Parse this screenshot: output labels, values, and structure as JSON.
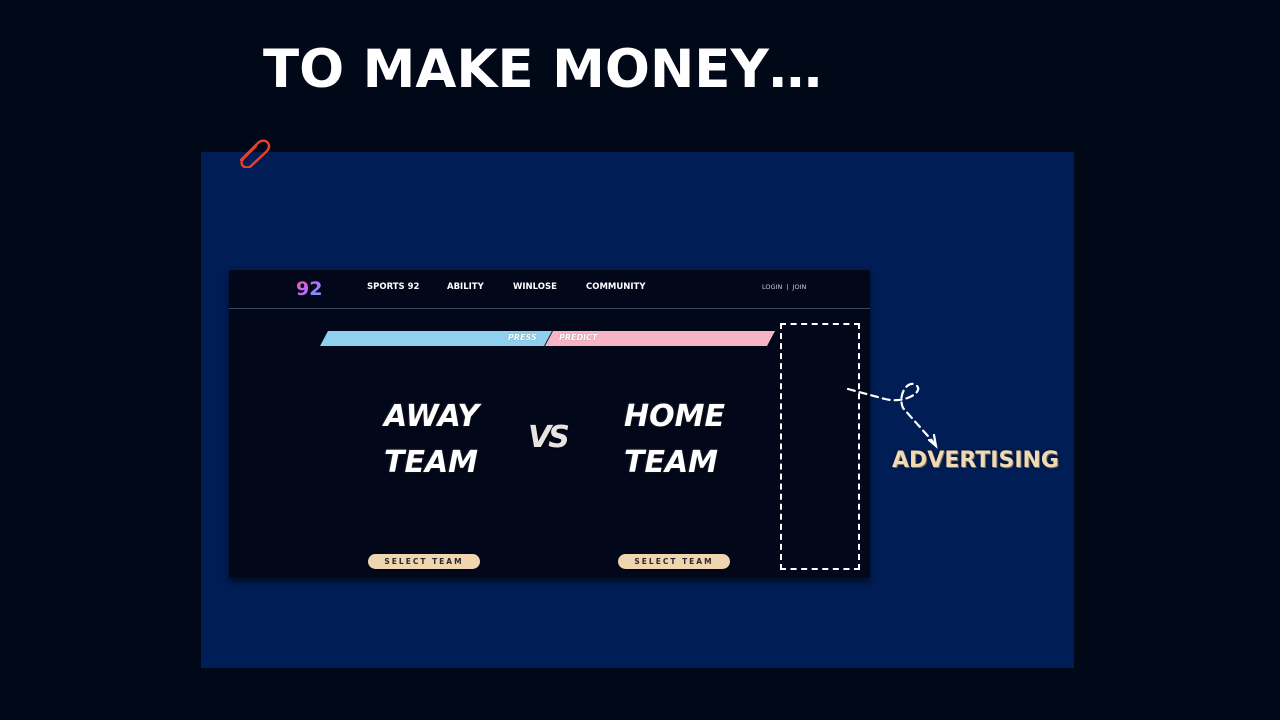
{
  "slide": {
    "title": "TO MAKE MONEY…",
    "annotation_label": "ADVERTISING"
  },
  "site": {
    "logo_text": "92",
    "nav": [
      "SPORTS 92",
      "ABILITY",
      "WINLOSE",
      "COMMUNITY"
    ],
    "auth": {
      "login": "LOGIN",
      "separator": "|",
      "join": "JOIN"
    },
    "bands": {
      "press": "PRESS",
      "predict": "PREDICT"
    },
    "away_team": {
      "line1": "AWAY",
      "line2": "TEAM"
    },
    "home_team": {
      "line1": "HOME",
      "line2": "TEAM"
    },
    "versus": "VS",
    "select_button_label": "SELECT TEAM"
  },
  "colors": {
    "page_bg": "#010818",
    "panel_bg": "#001d55",
    "site_bg": "#020819",
    "band_blue": "#8fd0ee",
    "band_pink": "#f6b4c4",
    "button_bg": "#efd5b0",
    "clip_icon": "#e8402a",
    "annotation_text": "#efd9b6"
  },
  "icons": [
    "paperclip-icon",
    "logo-92-icon",
    "dashed-arrow-icon"
  ]
}
